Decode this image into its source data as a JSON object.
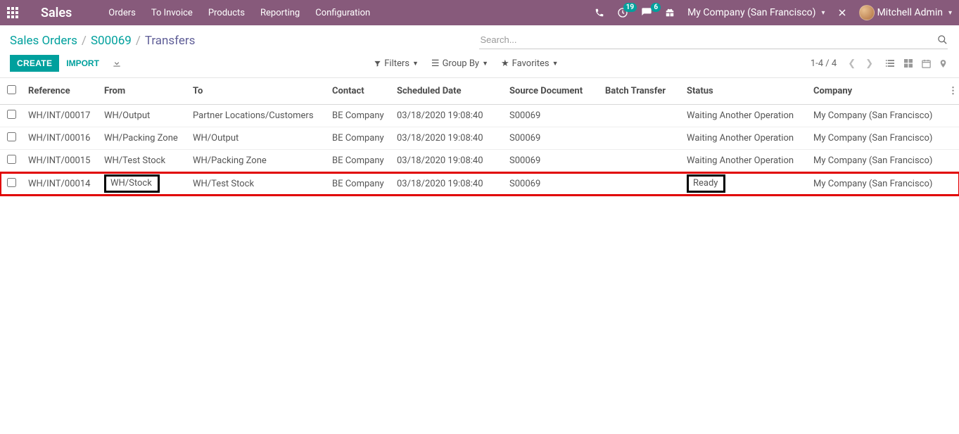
{
  "nav": {
    "brand": "Sales",
    "links": [
      "Orders",
      "To Invoice",
      "Products",
      "Reporting",
      "Configuration"
    ],
    "badge_activities": "19",
    "badge_messages": "6",
    "company": "My Company (San Francisco)",
    "user": "Mitchell Admin"
  },
  "breadcrumb": {
    "a": "Sales Orders",
    "b": "S00069",
    "c": "Transfers"
  },
  "search": {
    "placeholder": "Search..."
  },
  "toolbar": {
    "create": "CREATE",
    "import": "IMPORT",
    "filters": "Filters",
    "group_by": "Group By",
    "favorites": "Favorites",
    "pager": "1-4 / 4"
  },
  "columns": {
    "reference": "Reference",
    "from": "From",
    "to": "To",
    "contact": "Contact",
    "scheduled": "Scheduled Date",
    "source": "Source Document",
    "batch": "Batch Transfer",
    "status": "Status",
    "company": "Company"
  },
  "rows": [
    {
      "reference": "WH/INT/00017",
      "from": "WH/Output",
      "to": "Partner Locations/Customers",
      "contact": "BE Company",
      "scheduled": "03/18/2020 19:08:40",
      "source": "S00069",
      "batch": "",
      "status": "Waiting Another Operation",
      "company": "My Company (San Francisco)"
    },
    {
      "reference": "WH/INT/00016",
      "from": "WH/Packing Zone",
      "to": "WH/Output",
      "contact": "BE Company",
      "scheduled": "03/18/2020 19:08:40",
      "source": "S00069",
      "batch": "",
      "status": "Waiting Another Operation",
      "company": "My Company (San Francisco)"
    },
    {
      "reference": "WH/INT/00015",
      "from": "WH/Test Stock",
      "to": "WH/Packing Zone",
      "contact": "BE Company",
      "scheduled": "03/18/2020 19:08:40",
      "source": "S00069",
      "batch": "",
      "status": "Waiting Another Operation",
      "company": "My Company (San Francisco)"
    },
    {
      "reference": "WH/INT/00014",
      "from": "WH/Stock",
      "to": "WH/Test Stock",
      "contact": "BE Company",
      "scheduled": "03/18/2020 19:08:40",
      "source": "S00069",
      "batch": "",
      "status": "Ready",
      "company": "My Company (San Francisco)"
    }
  ]
}
